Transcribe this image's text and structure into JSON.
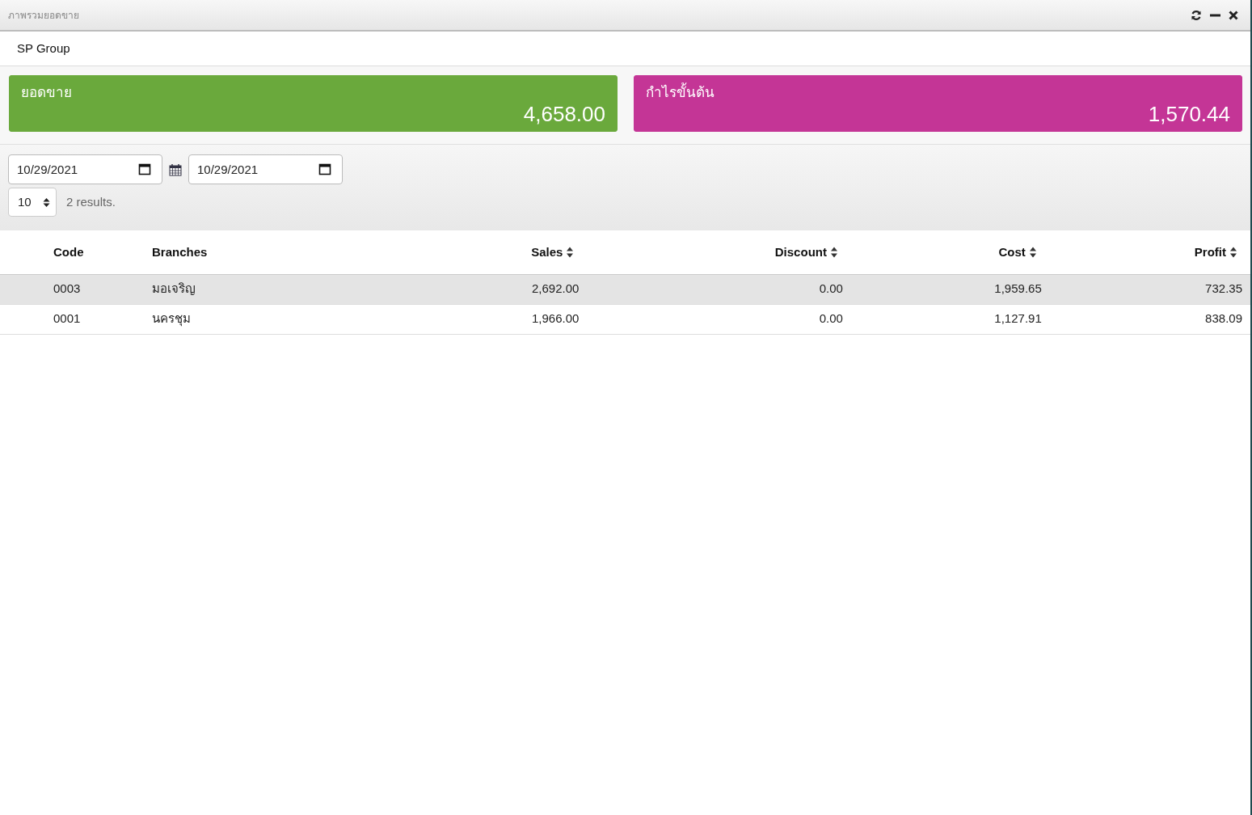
{
  "window": {
    "title": "ภาพรวมยอดขาย"
  },
  "company": "SP Group",
  "summary_cards": [
    {
      "label": "ยอดขาย",
      "value": "4,658.00",
      "color": "#6aa93c"
    },
    {
      "label": "กำไรขั้นต้น",
      "value": "1,570.44",
      "color": "#c43596"
    }
  ],
  "filters": {
    "date_from": "10/29/2021",
    "date_to": "10/29/2021",
    "page_size": "10",
    "result_count": "2 results."
  },
  "table": {
    "columns": [
      {
        "label": "Code",
        "sortable": false,
        "kind": "text"
      },
      {
        "label": "Branches",
        "sortable": false,
        "kind": "text"
      },
      {
        "label": "Sales",
        "sortable": true,
        "kind": "number"
      },
      {
        "label": "Discount",
        "sortable": true,
        "kind": "number"
      },
      {
        "label": "Cost",
        "sortable": true,
        "kind": "number"
      },
      {
        "label": "Profit",
        "sortable": true,
        "kind": "number"
      }
    ],
    "rows": [
      {
        "cells": [
          "0003",
          "มอเจริญ",
          "2,692.00",
          "0.00",
          "1,959.65",
          "732.35"
        ],
        "selected": true
      },
      {
        "cells": [
          "0001",
          "นครชุม",
          "1,966.00",
          "0.00",
          "1,127.91",
          "838.09"
        ],
        "selected": false
      }
    ]
  }
}
